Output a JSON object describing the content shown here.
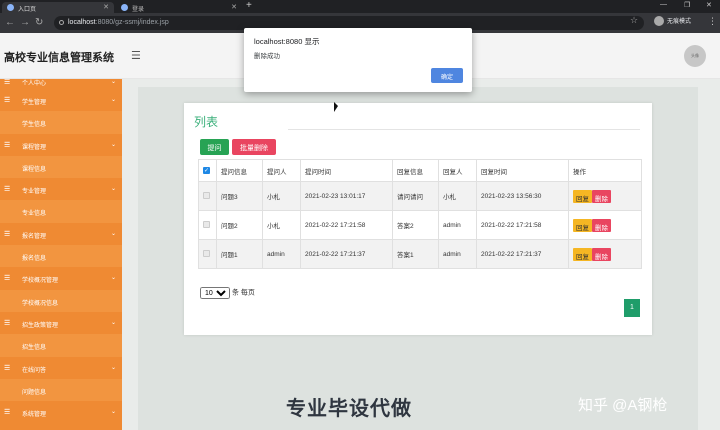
{
  "browser": {
    "tabs": [
      {
        "label": "入口页",
        "active": true
      },
      {
        "label": "登录",
        "active": false
      }
    ],
    "url_host": "localhost",
    "url_path": ":8080/gz-ssmj/index.jsp",
    "profile_label": "无痕模式"
  },
  "app": {
    "title": "高校专业信息管理系统",
    "avatar_label": "头像"
  },
  "sidebar": {
    "items": [
      {
        "label": "个人中心",
        "type": "group"
      },
      {
        "label": "学生管理",
        "type": "group"
      },
      {
        "label": "学生信息",
        "type": "child"
      },
      {
        "label": "课程管理",
        "type": "group"
      },
      {
        "label": "课程信息",
        "type": "child"
      },
      {
        "label": "专业管理",
        "type": "group"
      },
      {
        "label": "专业信息",
        "type": "child"
      },
      {
        "label": "报名管理",
        "type": "group"
      },
      {
        "label": "报名信息",
        "type": "child"
      },
      {
        "label": "学校概况管理",
        "type": "group"
      },
      {
        "label": "学校概况信息",
        "type": "child"
      },
      {
        "label": "招生政策管理",
        "type": "group"
      },
      {
        "label": "招生信息",
        "type": "child"
      },
      {
        "label": "在线问答",
        "type": "group"
      },
      {
        "label": "问题信息",
        "type": "child"
      },
      {
        "label": "系统管理",
        "type": "group"
      }
    ]
  },
  "list": {
    "title": "列表",
    "ask_button": "提问",
    "bulk_delete_button": "批量删除",
    "columns": [
      "提问信息",
      "提问人",
      "提问时间",
      "回复信息",
      "回复人",
      "回复时间",
      "操作"
    ],
    "rows": [
      {
        "question": "问题3",
        "asker": "小札",
        "ask_time": "2021-02-23 13:01:17",
        "reply": "请问请问",
        "replier": "小札",
        "reply_time": "2021-02-23 13:56:30"
      },
      {
        "question": "问题2",
        "asker": "小札",
        "ask_time": "2021-02-22 17:21:58",
        "reply": "答案2",
        "replier": "admin",
        "reply_time": "2021-02-22 17:21:58"
      },
      {
        "question": "问题1",
        "asker": "admin",
        "ask_time": "2021-02-22 17:21:37",
        "reply": "答案1",
        "replier": "admin",
        "reply_time": "2021-02-22 17:21:37"
      }
    ],
    "edit_label": "回复",
    "delete_label": "删除",
    "page_size": "10",
    "page_size_suffix": "条 每页",
    "current_page": "1"
  },
  "dialog": {
    "title": "localhost:8080 显示",
    "message": "删除成功",
    "ok_label": "确定"
  },
  "watermarks": {
    "center": "专业毕设代做",
    "right": "知乎 @A钢枪"
  }
}
